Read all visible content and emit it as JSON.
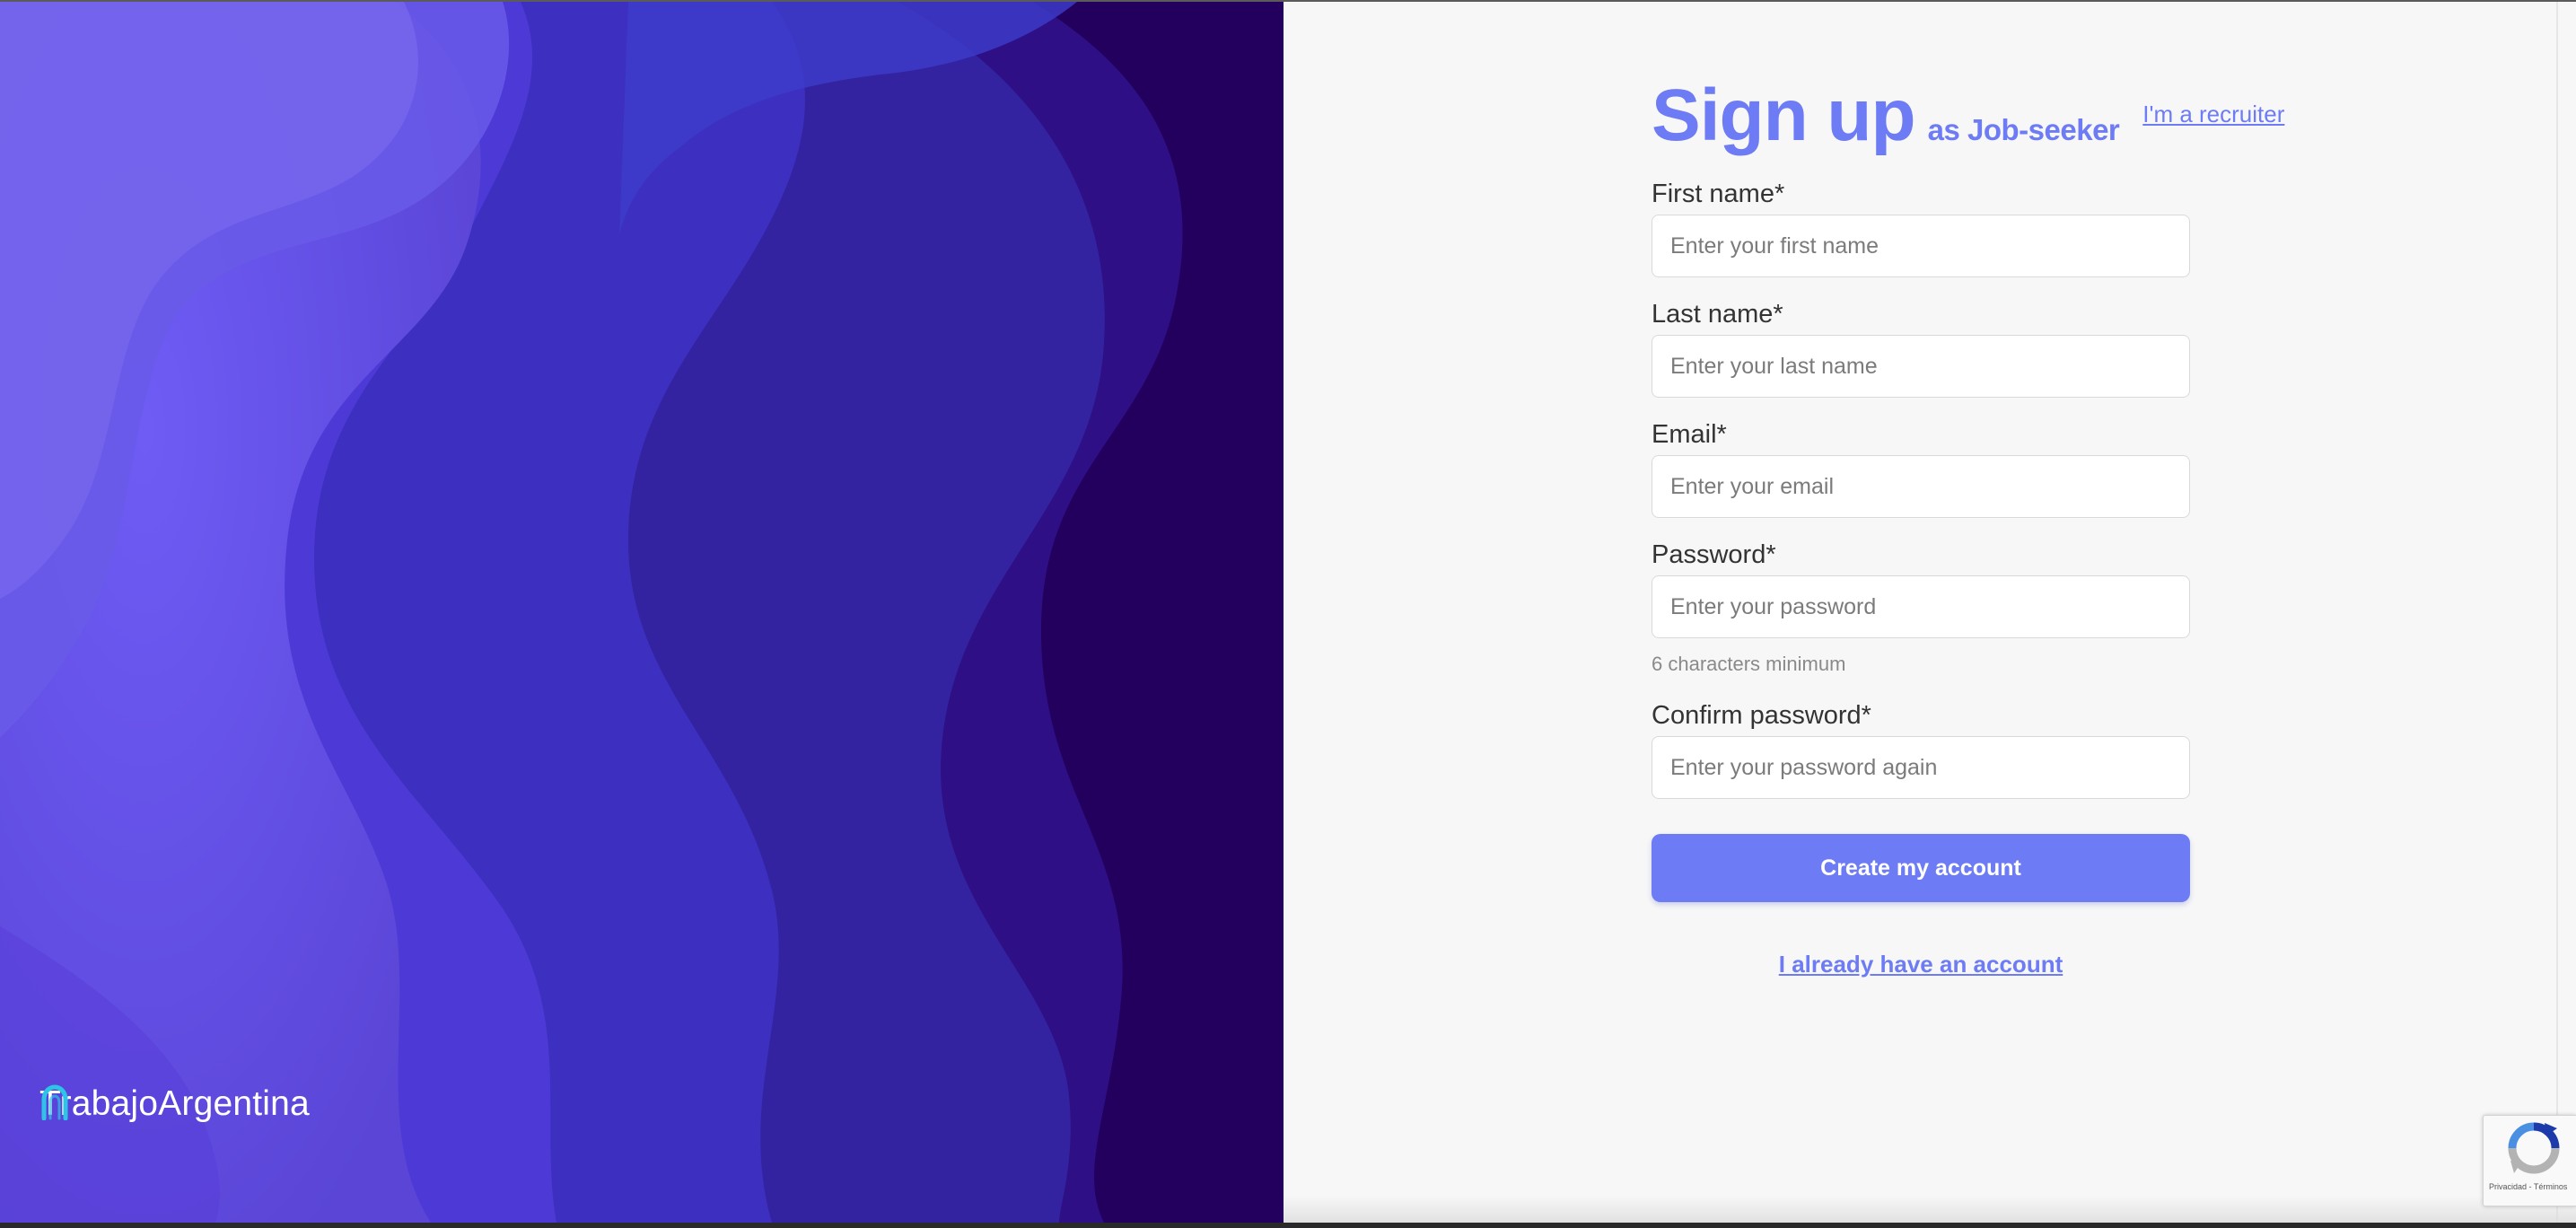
{
  "brand": {
    "name": "TrabajoArgentina",
    "icon": "trabajo-logo-icon",
    "icon_color": "#2ec4e6"
  },
  "heading": {
    "title": "Sign up",
    "subtitle": "as Job-seeker",
    "alt_link": "I'm a recruiter"
  },
  "fields": {
    "first_name": {
      "label": "First name*",
      "placeholder": "Enter your first name"
    },
    "last_name": {
      "label": "Last name*",
      "placeholder": "Enter your last name"
    },
    "email": {
      "label": "Email*",
      "placeholder": "Enter your email"
    },
    "password": {
      "label": "Password*",
      "placeholder": "Enter your password",
      "hint": "6 characters minimum"
    },
    "confirm_password": {
      "label": "Confirm password*",
      "placeholder": "Enter your password again"
    }
  },
  "actions": {
    "submit_label": "Create my account",
    "login_link": "I already have an account"
  },
  "recaptcha": {
    "icon": "recaptcha-icon",
    "text": "Privacidad - Términos"
  },
  "colors": {
    "accent": "#6d7cf4",
    "hero_dark": "#2a0068",
    "hero_light": "#7b6cf2",
    "panel_bg": "#f7f7f7"
  }
}
